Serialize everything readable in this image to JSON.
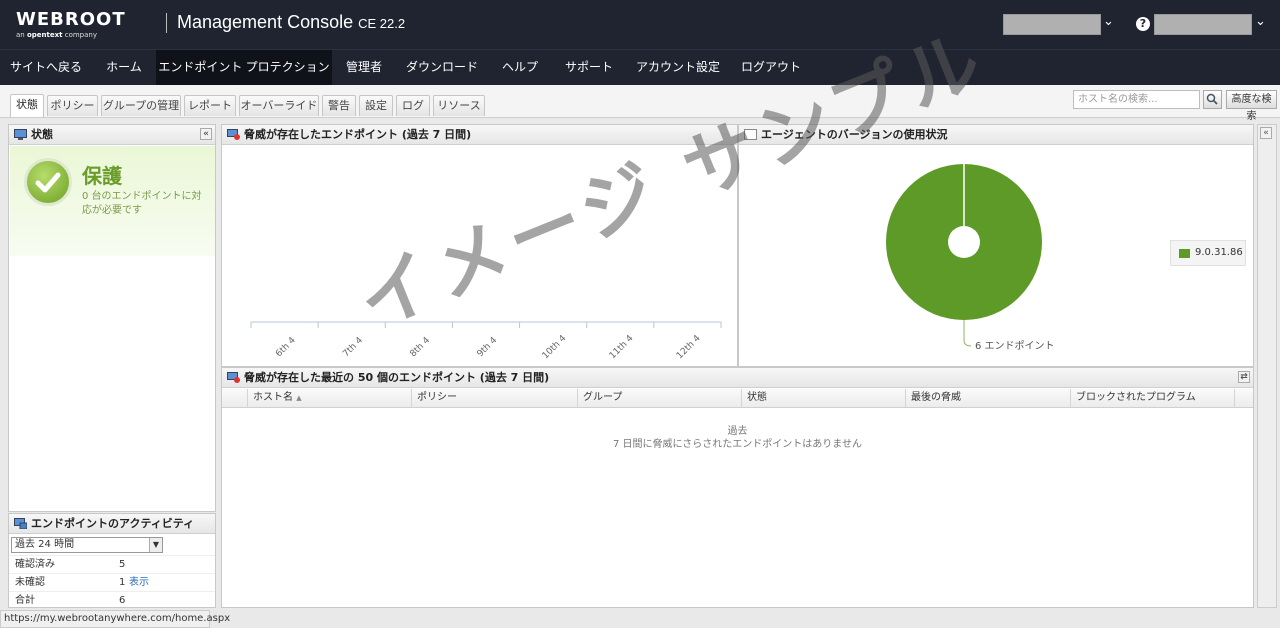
{
  "header": {
    "logo_word": "WEBROOT",
    "logo_sub_prefix": "an",
    "logo_sub_brand": "opentext",
    "logo_sub_suffix": "company",
    "title": "Management Console",
    "version": "CE 22.2"
  },
  "nav": {
    "items": [
      "サイトへ戻る",
      "ホーム",
      "エンドポイント プロテクション",
      "管理者",
      "ダウンロード",
      "ヘルプ",
      "サポート",
      "アカウント設定",
      "ログアウト"
    ],
    "active": "エンドポイント プロテクション"
  },
  "subtabs": {
    "items": [
      "状態",
      "ポリシー",
      "グループの管理",
      "レポート",
      "オーバーライド",
      "警告",
      "設定",
      "ログ",
      "リソース"
    ],
    "active": "状態"
  },
  "search": {
    "placeholder": "ホスト名の検索...",
    "advanced_label": "高度な検索"
  },
  "status_panel": {
    "title": "状態",
    "state": "保護",
    "detail": "0 台のエンドポイントに対応が必要です"
  },
  "threat_chart_panel": {
    "title": "脅威が存在したエンドポイント (過去 7 日間)"
  },
  "agent_panel": {
    "title": "エージェントのバージョンの使用状況",
    "slice_label": "6 エンドポイント"
  },
  "chart_data": [
    {
      "type": "line",
      "title": "脅威が存在したエンドポイント (過去 7 日間)",
      "categories": [
        "6th 4",
        "7th 4",
        "8th 4",
        "9th 4",
        "10th 4",
        "11th 4",
        "12th 4"
      ],
      "series": []
    },
    {
      "type": "pie",
      "title": "エージェントのバージョンの使用状況",
      "slices": [
        {
          "label": "9.0.31.86",
          "value": 6
        }
      ],
      "legend": [
        "9.0.31.86"
      ],
      "legend_position": "right",
      "colors": [
        "#5e9a27"
      ]
    }
  ],
  "recent_panel": {
    "title": "脅威が存在した最近の 50 個のエンドポイント (過去 7 日間)",
    "columns": [
      "ホスト名",
      "ポリシー",
      "グループ",
      "状態",
      "最後の脅威",
      "ブロックされたプログラム"
    ],
    "empty_line1": "過去",
    "empty_line2": "7 日間に脅威にさらされたエンドポイントはありません"
  },
  "activity_panel": {
    "title": "エンドポイントのアクティビティ",
    "period": "過去 24 時間",
    "rows": [
      {
        "label": "確認済み",
        "value": "5"
      },
      {
        "label": "未確認",
        "value": "1",
        "link": "表示"
      },
      {
        "label": "合計",
        "value": "6"
      }
    ]
  },
  "statusbar": {
    "url": "https://my.webrootanywhere.com/home.aspx"
  },
  "watermark": "イメージ サンプル",
  "colors": {
    "header_bg": "#1f2430",
    "accent_green": "#5e9a27",
    "link": "#2a6ebb"
  }
}
